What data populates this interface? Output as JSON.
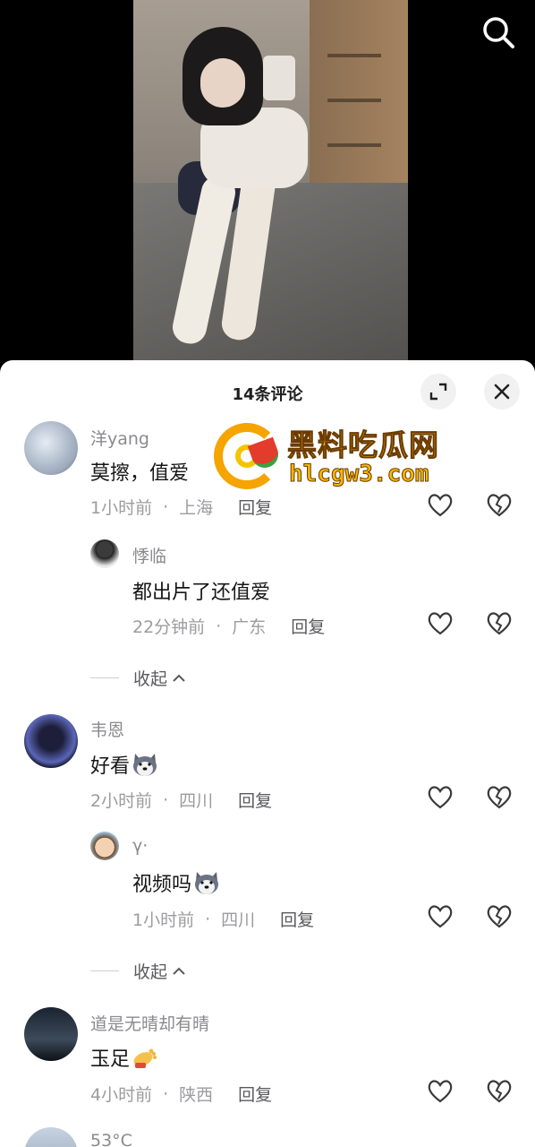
{
  "header": {
    "comment_count_title": "14条评论",
    "expand_icon": "expand-icon",
    "close_icon": "close-icon",
    "search_icon": "search-icon"
  },
  "watermark": {
    "title": "黑料吃瓜网",
    "url": "hlcgw3.com"
  },
  "comments": [
    {
      "user": "洋yang",
      "text": "莫擦，值爱",
      "time": "1小时前",
      "location": "上海",
      "reply_label": "回复",
      "replies": [
        {
          "user": "悸临",
          "text": "都出片了还值爱",
          "time": "22分钟前",
          "location": "广东",
          "reply_label": "回复"
        }
      ],
      "collapse_label": "收起"
    },
    {
      "user": "韦恩",
      "text": "好看",
      "emoji": "husky-emoji",
      "time": "2小时前",
      "location": "四川",
      "reply_label": "回复",
      "replies": [
        {
          "user": "γ·",
          "text": "视频吗",
          "emoji": "husky-emoji",
          "time": "1小时前",
          "location": "四川",
          "reply_label": "回复"
        }
      ],
      "collapse_label": "收起"
    },
    {
      "user": "道是无晴却有晴",
      "text": "玉足",
      "emoji": "foot-emoji",
      "time": "4小时前",
      "location": "陕西",
      "reply_label": "回复"
    },
    {
      "user": "53°C"
    }
  ],
  "colors": {
    "accent_watermark": "#f5b800",
    "text_primary": "#161616",
    "text_secondary": "#8a8a8e"
  }
}
